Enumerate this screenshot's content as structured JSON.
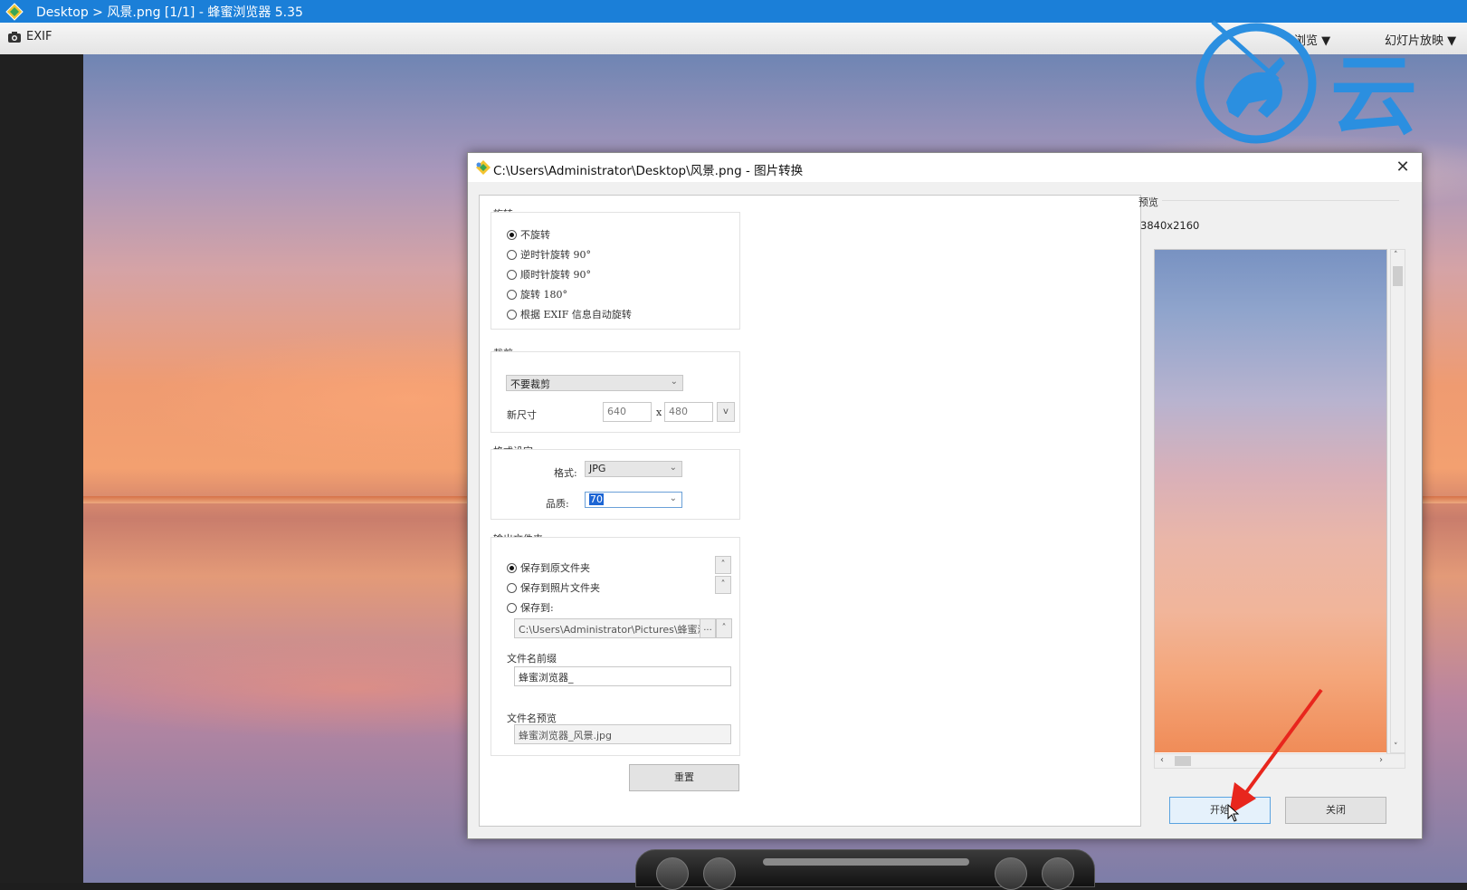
{
  "app": {
    "title": "Desktop > 风景.png [1/1] - 蜂蜜浏览器 5.35",
    "toolbar": {
      "exif_label": "EXIF",
      "browse_label": "浏览 ▼",
      "slideshow_label": "幻灯片放映 ▼"
    },
    "watermark_text": "云"
  },
  "dialog": {
    "title": "C:\\Users\\Administrator\\Desktop\\风景.png - 图片转换",
    "close_glyph": "✕",
    "rotation": {
      "legend": "旋转",
      "options": [
        {
          "label": "不旋转",
          "selected": true
        },
        {
          "label": "逆时针旋转 90°",
          "selected": false
        },
        {
          "label": "顺时针旋转 90°",
          "selected": false
        },
        {
          "label": "旋转 180°",
          "selected": false
        },
        {
          "label": "根据 EXIF 信息自动旋转",
          "selected": false
        }
      ]
    },
    "crop": {
      "legend": "裁剪",
      "mode_value": "不要裁剪",
      "size_label": "新尺寸",
      "width_value": "640",
      "x_sep": "x",
      "height_value": "480",
      "size_dropdown_glyph": "v"
    },
    "format": {
      "legend": "格式设定",
      "format_label": "格式:",
      "format_value": "JPG",
      "quality_label": "品质:",
      "quality_value": "70"
    },
    "output": {
      "legend": "输出文件夹",
      "options": [
        {
          "label": "保存到原文件夹",
          "selected": true
        },
        {
          "label": "保存到照片文件夹",
          "selected": false
        },
        {
          "label": "保存到:",
          "selected": false
        }
      ],
      "path_value": "C:\\Users\\Administrator\\Pictures\\蜂蜜浏",
      "browse_glyph": "...",
      "prefix_label": "文件名前缀",
      "prefix_value": "蜂蜜浏览器_",
      "preview_label": "文件名预览",
      "preview_value": "蜂蜜浏览器_风景.jpg"
    },
    "reset_label": "重置",
    "preview": {
      "legend": "预览",
      "size_text": "3840x2160"
    },
    "start_label": "开始",
    "close_label": "关闭"
  }
}
